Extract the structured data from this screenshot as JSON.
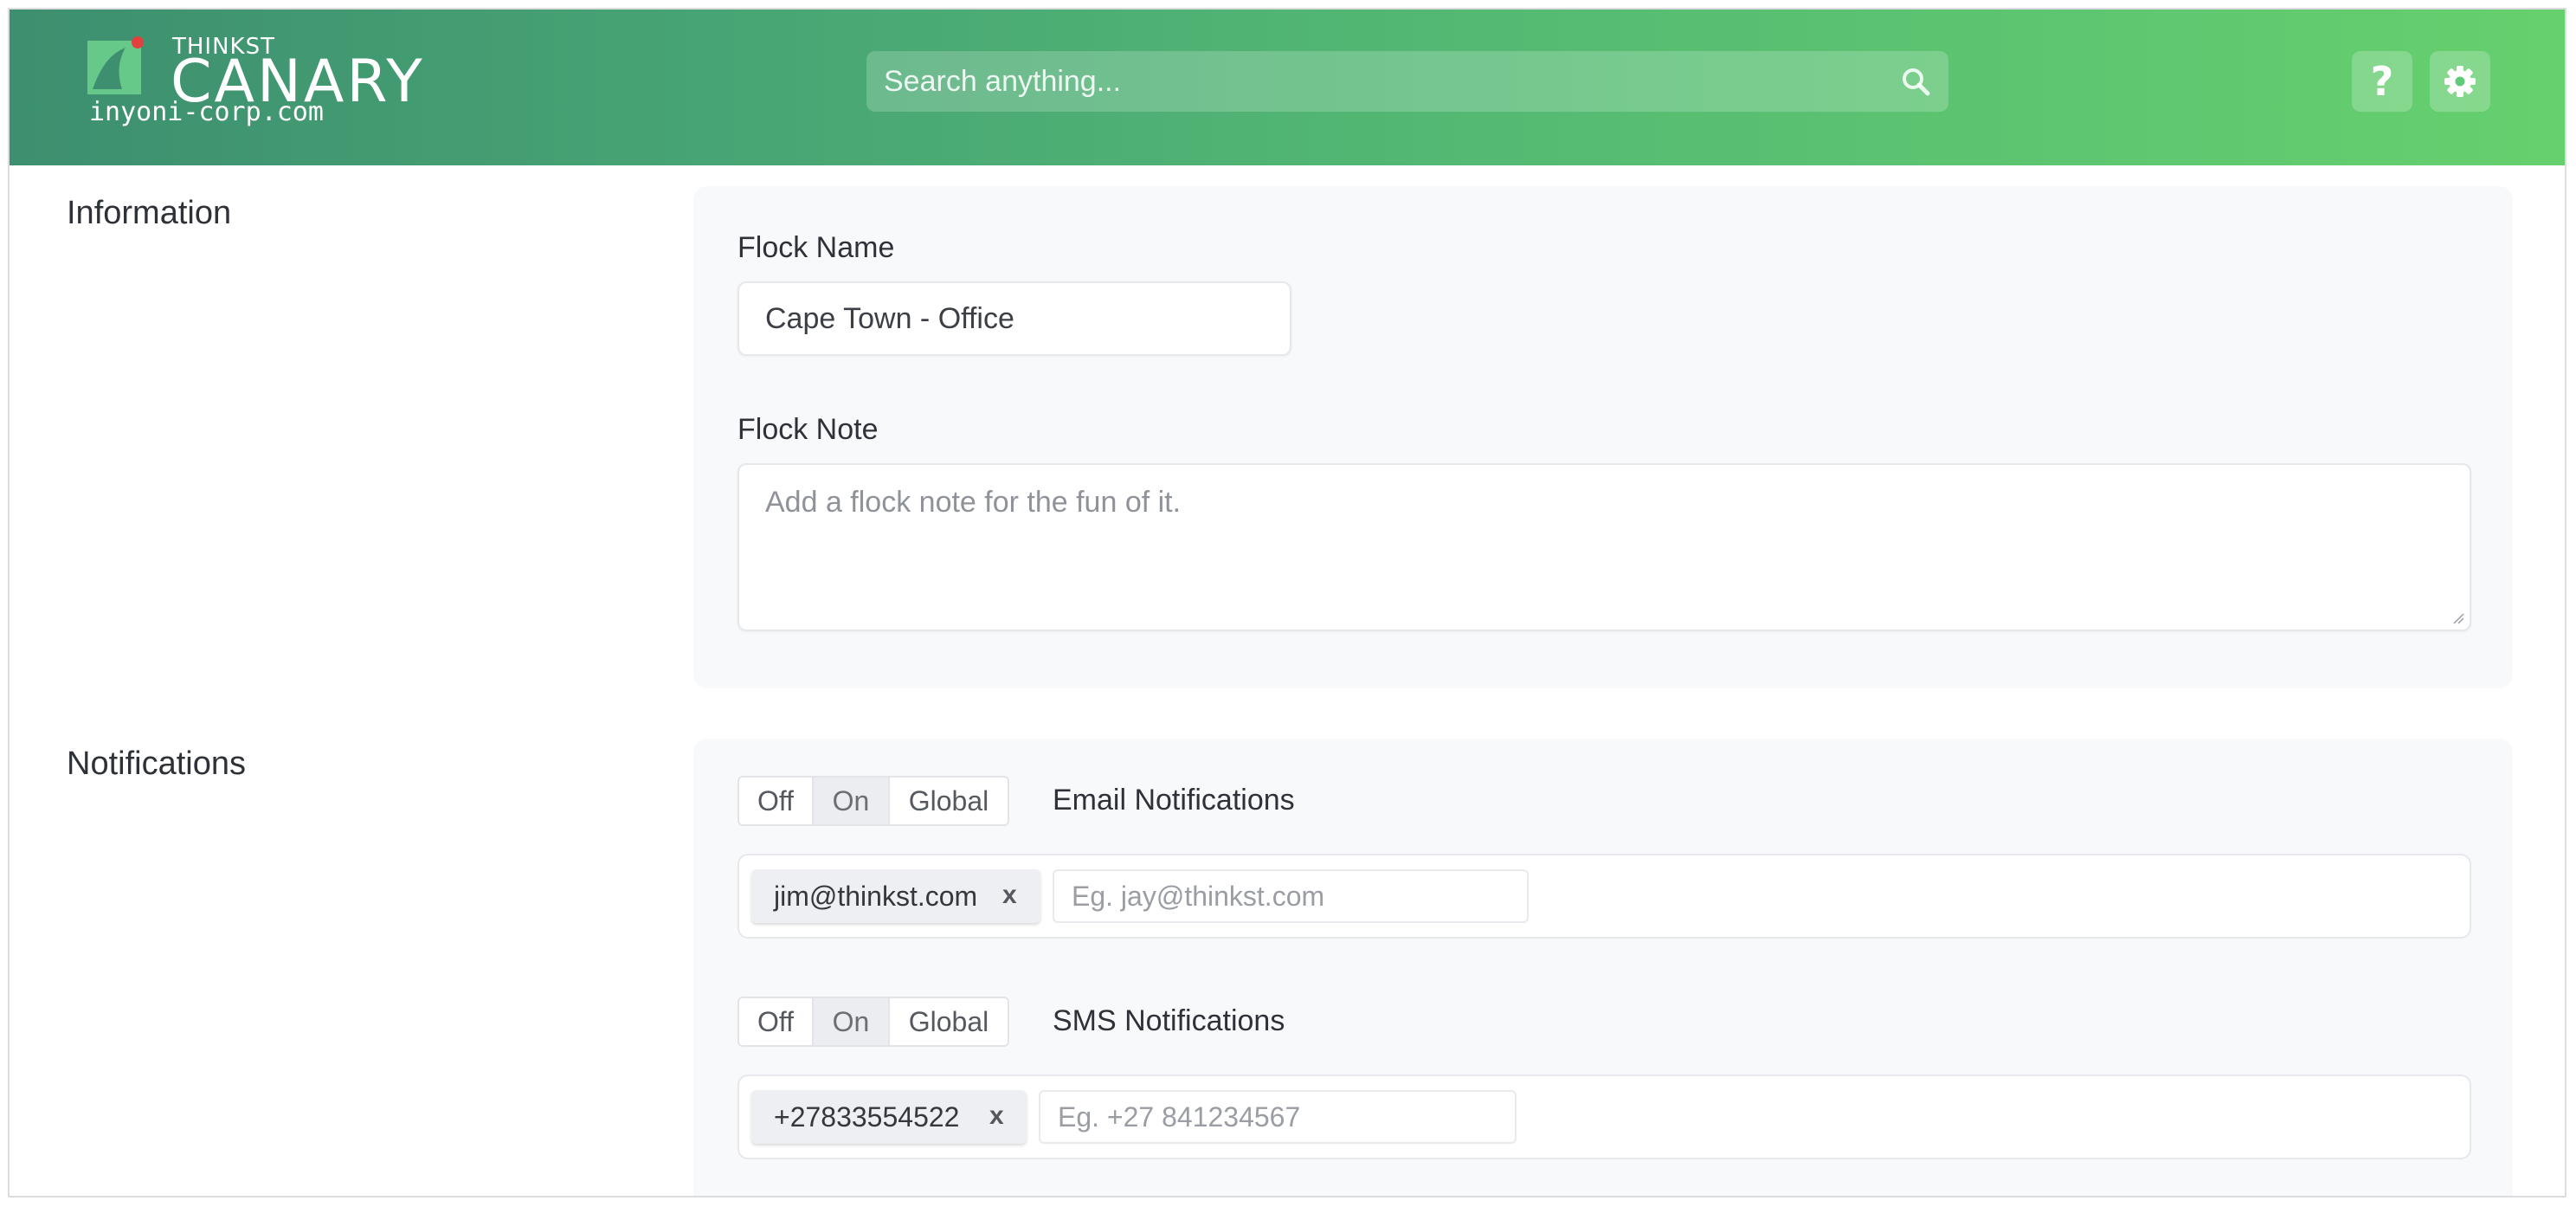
{
  "header": {
    "brand_top": "THINKST",
    "brand_main": "CANARY",
    "domain": "inyoni-corp.com",
    "search_placeholder": "Search anything...",
    "help_label": "?",
    "colors": {
      "gradient_start": "#3d8f6f",
      "gradient_end": "#66d06e",
      "logo_dot": "#e0413f"
    }
  },
  "information": {
    "section_title": "Information",
    "flock_name_label": "Flock Name",
    "flock_name_value": "Cape Town - Office",
    "flock_note_label": "Flock Note",
    "flock_note_placeholder": "Add a flock note for the fun of it."
  },
  "notifications": {
    "section_title": "Notifications",
    "email": {
      "label": "Email Notifications",
      "options": [
        "Off",
        "On",
        "Global"
      ],
      "selected": "On",
      "tags": [
        "jim@thinkst.com"
      ],
      "remove_label": "x",
      "input_placeholder": "Eg. jay@thinkst.com"
    },
    "sms": {
      "label": "SMS Notifications",
      "options": [
        "Off",
        "On",
        "Global"
      ],
      "selected": "On",
      "tags": [
        "+27833554522"
      ],
      "remove_label": "x",
      "input_placeholder": "Eg. +27 841234567"
    }
  }
}
